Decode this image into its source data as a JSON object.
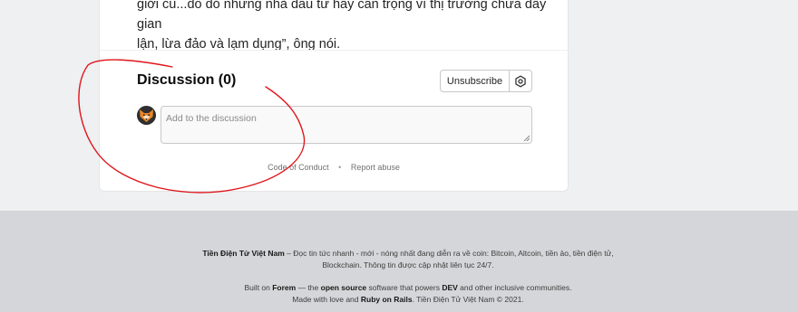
{
  "article": {
    "lines": [
      "giới cũ...do đó những nhà đầu tư hãy cẩn trọng vì thị trường chứa đầy gian",
      "lận, lừa đảo và lạm dụng”, ông nói."
    ]
  },
  "discussion": {
    "title": "Discussion (0)",
    "unsubscribe_label": "Unsubscribe",
    "comment_placeholder": "Add to the discussion"
  },
  "card_links": {
    "code_of_conduct": "Code of Conduct",
    "separator": "•",
    "report_abuse": "Report abuse"
  },
  "footer": {
    "site_name": "Tiền Điện Tử Việt Nam",
    "description": " – Đọc tin tức nhanh - mới - nóng nhất đang diễn ra về coin: Bitcoin, Altcoin, tiền ảo, tiền điện tử, Blockchain. Thông tin được cập nhật liên tục 24/7.",
    "built_on": "Built on ",
    "forem": "Forem",
    "dash": " — the ",
    "open_source": "open source",
    "powers": " software that powers ",
    "dev": "DEV",
    "rest": " and other inclusive communities.",
    "made_with": "Made with love and ",
    "ruby": "Ruby on Rails",
    "copyright": ". Tiền Điện Tử Việt Nam © 2021."
  },
  "icons": {
    "settings": "gear-icon",
    "avatar": "fox-avatar"
  },
  "colors": {
    "annotation": "#e0141a",
    "footer_bg": "#d5d6d9"
  }
}
